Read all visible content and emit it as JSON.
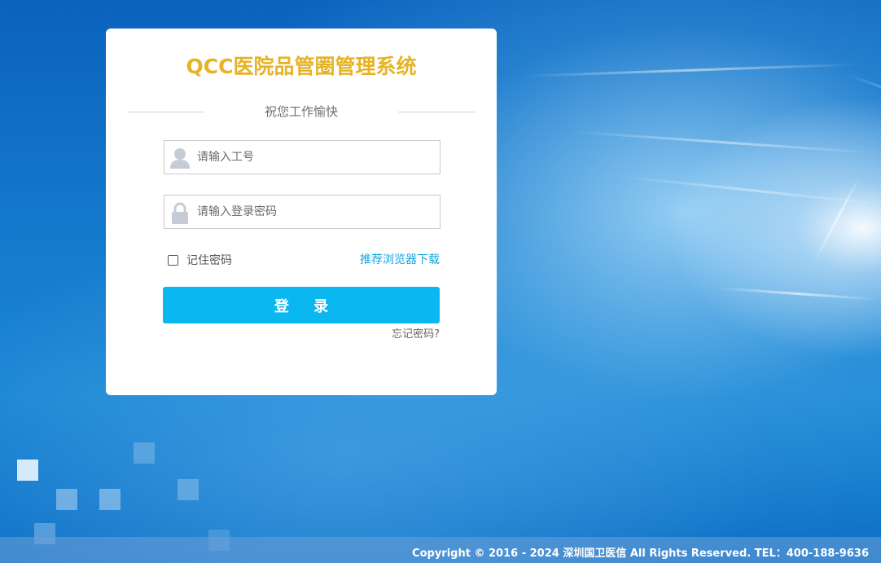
{
  "app": {
    "title": "QCC医院品管圈管理系统",
    "subtitle": "祝您工作愉快"
  },
  "form": {
    "username_placeholder": "请输入工号",
    "username_value": "",
    "password_placeholder": "请输入登录密码",
    "password_value": "",
    "remember_label": "记住密码",
    "remember_checked": false,
    "browser_download_link": "推荐浏览器下载",
    "login_button": "登  录",
    "forgot_password": "忘记密码?"
  },
  "footer": {
    "copyright": "Copyright © 2016 - 2024 深圳国卫医信 All Rights Reserved. TEL：400-188-9636"
  },
  "colors": {
    "title": "#e5b325",
    "primary_button": "#0ab7f0",
    "link": "#14a5e0",
    "background": "#1479cc"
  },
  "icons": {
    "username": "user-icon",
    "password": "lock-icon",
    "remember": "checkbox"
  }
}
